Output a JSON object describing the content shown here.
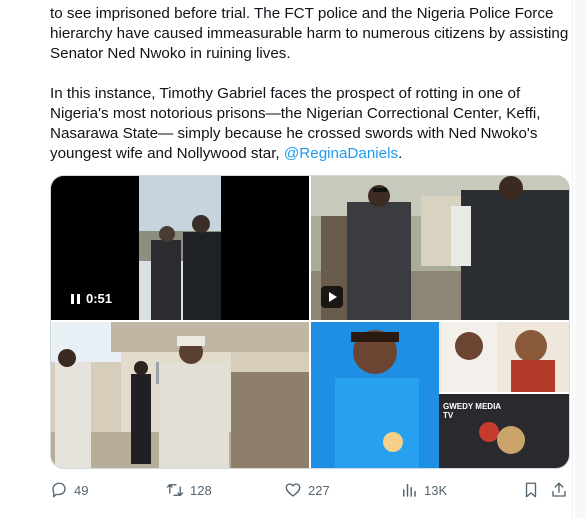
{
  "tweet": {
    "paragraph1": "to see imprisoned before trial. The FCT police and the Nigeria Police Force hierarchy have caused immeasurable harm to numerous citizens by assisting Senator Ned Nwoko in ruining lives.",
    "paragraph2": "In this instance, Timothy Gabriel faces the prospect of rotting in one of Nigeria's most notorious prisons—the Nigerian Correctional Center, Keffi, Nasarawa State— simply because he crossed swords with Ned Nwoko's youngest wife and Nollywood star,",
    "mention": "@ReginaDaniels",
    "trailing": "."
  },
  "media": {
    "video_duration": "0:51",
    "overlay_text": "GWEDY MEDIA TV"
  },
  "actions": {
    "replies": "49",
    "reposts": "128",
    "likes": "227",
    "views": "13K"
  },
  "icons": {
    "reply": "reply-icon",
    "repost": "repost-icon",
    "like": "heart-icon",
    "views": "views-icon",
    "bookmark": "bookmark-icon",
    "share": "share-icon",
    "pause": "pause-icon",
    "play": "play-icon"
  },
  "colors": {
    "text": "#0f1419",
    "muted": "#536471",
    "link": "#1d9bf0",
    "border": "#cfd9de"
  }
}
